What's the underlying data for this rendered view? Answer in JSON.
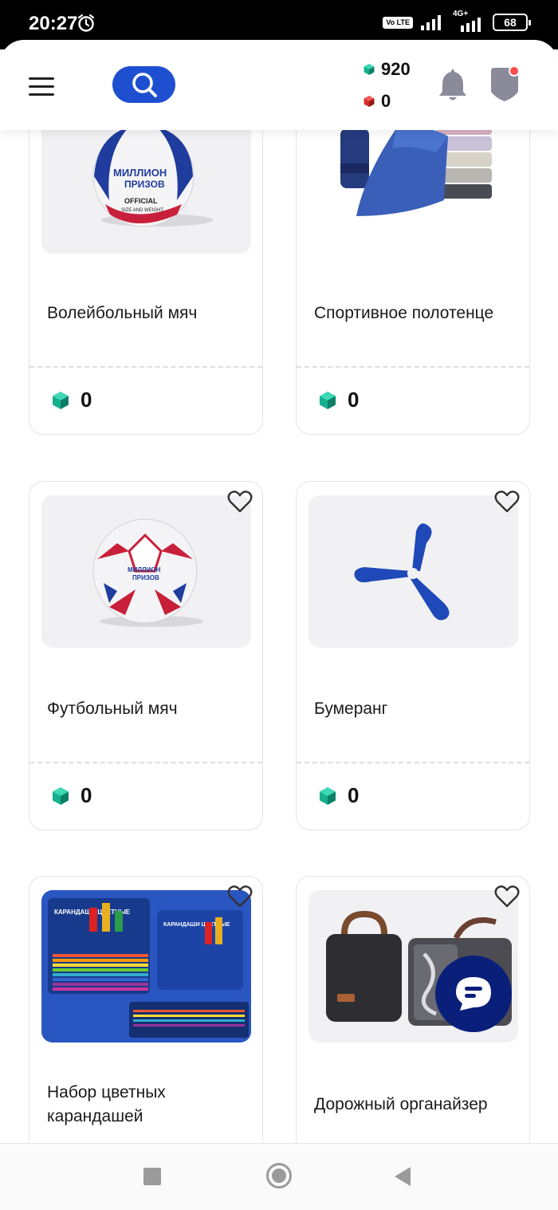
{
  "status_bar": {
    "time": "20:27",
    "volte": "Vo LTE",
    "network": "4G+",
    "battery": "68"
  },
  "header": {
    "gems_balance": "920",
    "rubies_balance": "0",
    "notification_dot_color": "#ff4b4b",
    "accent_color": "#1f4fd1"
  },
  "products": [
    {
      "title": "Волейбольный мяч",
      "price": "0",
      "image_icon": "volleyball"
    },
    {
      "title": "Спортивное полотенце",
      "price": "0",
      "image_icon": "sport-towel"
    },
    {
      "title": "Футбольный мяч",
      "price": "0",
      "image_icon": "football"
    },
    {
      "title": "Бумеранг",
      "price": "0",
      "image_icon": "boomerang"
    },
    {
      "title": "Набор цветных карандашей",
      "price": "",
      "image_icon": "colored-pencils"
    },
    {
      "title": "Дорожный органайзер",
      "price": "",
      "image_icon": "travel-organizer"
    }
  ],
  "brand_image_text": {
    "ball_logo_line1": "МИЛЛИОН",
    "ball_logo_line2": "ПРИЗОВ",
    "ball_official": "OFFICIAL",
    "ball_size": "SIZE AND WEIGHT",
    "pencils_tin": "КАРАНДАШИ ЦВЕТНЫЕ"
  }
}
